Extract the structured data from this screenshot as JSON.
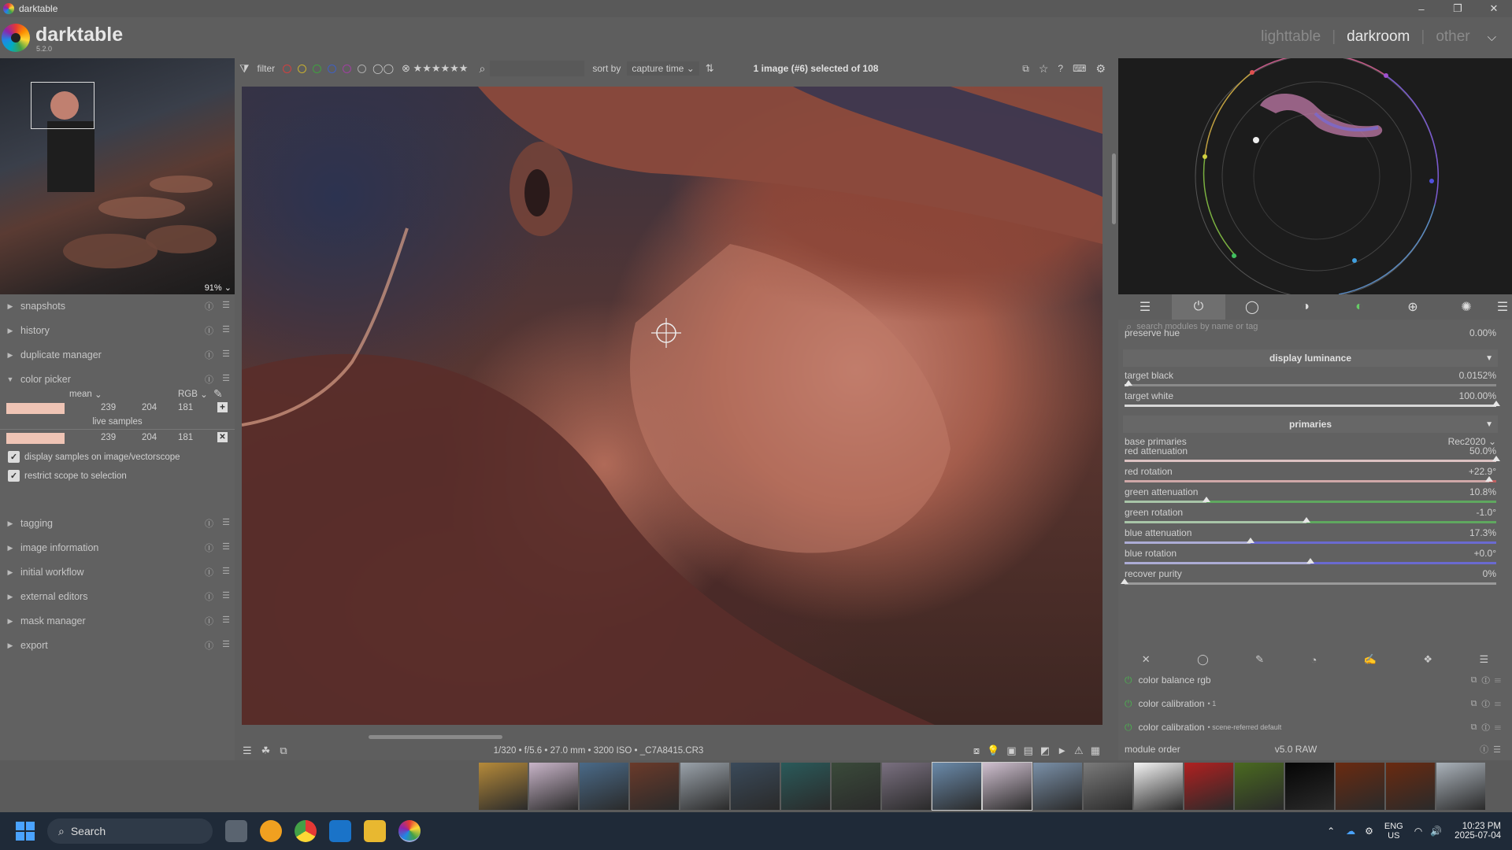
{
  "window": {
    "title": "darktable"
  },
  "header": {
    "brand": "darktable",
    "version": "5.2.0",
    "views": [
      "lighttable",
      "darkroom",
      "other"
    ],
    "active_view": "darkroom"
  },
  "navigator": {
    "zoom": "91%"
  },
  "left_modules": {
    "snapshots": "snapshots",
    "history": "history",
    "duplicate_manager": "duplicate manager",
    "color_picker": "color picker",
    "tagging": "tagging",
    "image_information": "image information",
    "initial_workflow": "initial workflow",
    "external_editors": "external editors",
    "mask_manager": "mask manager",
    "export": "export"
  },
  "color_picker": {
    "stat": "mean",
    "model": "RGB",
    "values": [
      "239",
      "204",
      "181"
    ],
    "live_samples_label": "live samples",
    "live_values": [
      "239",
      "204",
      "181"
    ],
    "swatch_color": "#efc4b5",
    "display_samples_label": "display samples on image/vectorscope",
    "restrict_scope_label": "restrict scope to selection"
  },
  "topbar": {
    "filter_label": "filter",
    "sort_by_label": "sort by",
    "sort_value": "capture time",
    "selection_prefix": "1 image (",
    "selection_number": "#6",
    "selection_mid": ") selected of ",
    "selection_total": "108"
  },
  "bottombar": {
    "exif": "1/320 • f/5.6 • 27.0 mm • 3200 ISO • _C7A8415.CR3"
  },
  "right_panel": {
    "search_placeholder": "search modules by name or tag",
    "preserve_hue": {
      "label": "preserve hue",
      "value": "0.00%"
    },
    "display_luminance": "display luminance",
    "target_black": {
      "label": "target black",
      "value": "0.0152%",
      "level": 0.01
    },
    "target_white": {
      "label": "target white",
      "value": "100.00%",
      "level": 1.0
    },
    "primaries": "primaries",
    "base_primaries": {
      "label": "base primaries",
      "value": "Rec2020"
    },
    "sliders": [
      {
        "label": "red attenuation",
        "value": "50.0%",
        "level": 1.0,
        "color": "#e0a0a0"
      },
      {
        "label": "red rotation",
        "value": "+22.9°",
        "level": 0.98,
        "color": "#c06060"
      },
      {
        "label": "green attenuation",
        "value": "10.8%",
        "level": 0.22,
        "color": "#5fa85f"
      },
      {
        "label": "green rotation",
        "value": "-1.0°",
        "level": 0.49,
        "color": "#5fa85f"
      },
      {
        "label": "blue attenuation",
        "value": "17.3%",
        "level": 0.34,
        "color": "#6a6ad0"
      },
      {
        "label": "blue rotation",
        "value": "+0.0°",
        "level": 0.5,
        "color": "#6a6ad0"
      },
      {
        "label": "recover purity",
        "value": "0%",
        "level": 0.0,
        "color": "#9a9a9a"
      }
    ],
    "pipeline": [
      {
        "label": "color balance rgb",
        "suffix": ""
      },
      {
        "label": "color calibration",
        "suffix": "• 1"
      },
      {
        "label": "color calibration",
        "suffix": "• scene-referred default"
      }
    ],
    "module_order_label": "module order",
    "module_order_value": "v5.0 RAW"
  },
  "taskbar": {
    "search_label": "Search",
    "lang": "ENG",
    "region": "US",
    "time": "10:23 PM",
    "date": "2025-07-04"
  },
  "filmstrip": {
    "thumb_colors": [
      "#b58a3a",
      "#c8b4c8",
      "#4a6a88",
      "#6a3a2a",
      "#9aa2aa",
      "#3a4a5a",
      "#2a5a5a",
      "#3a4a3a",
      "#7a7080",
      "#6a8aaa",
      "#d0c0d0",
      "#7a90a8",
      "#7a7a7a",
      "#f4f4f4",
      "#b02020",
      "#4a6a20",
      "#050505",
      "#6a2a10",
      "#6a2a10",
      "#aab2ba"
    ]
  }
}
